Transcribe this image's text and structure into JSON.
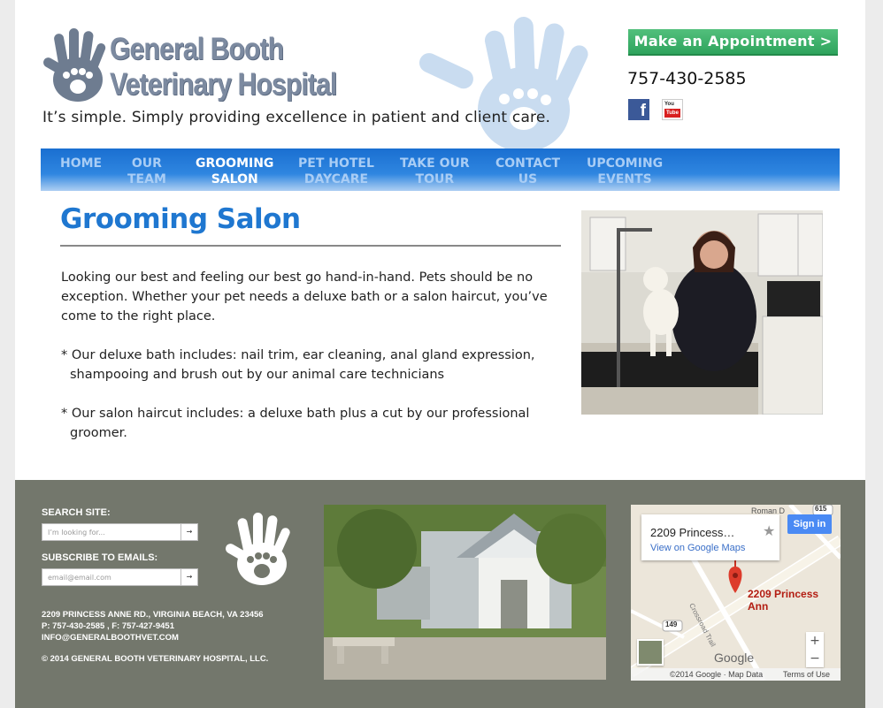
{
  "header": {
    "logo_line1": "General Booth",
    "logo_line2": "Veterinary Hospital",
    "tagline": "It’s simple. Simply providing excellence in patient and client care.",
    "appointment_button": "Make an Appointment >",
    "phone": "757-430-2585",
    "social": {
      "facebook_icon": "facebook-icon",
      "youtube_icon": "youtube-icon",
      "youtube_top": "You",
      "youtube_bottom": "Tube"
    }
  },
  "nav": {
    "items": [
      {
        "line1": "HOME",
        "line2": ""
      },
      {
        "line1": "OUR",
        "line2": "TEAM"
      },
      {
        "line1": "GROOMING",
        "line2": "SALON"
      },
      {
        "line1": "PET HOTEL",
        "line2": "DAYCARE"
      },
      {
        "line1": "TAKE OUR",
        "line2": "TOUR"
      },
      {
        "line1": "CONTACT",
        "line2": "US"
      },
      {
        "line1": "UPCOMING",
        "line2": "EVENTS"
      }
    ],
    "active_index": 2
  },
  "main": {
    "title": "Grooming Salon",
    "paragraphs": [
      "Looking our best and feeling our best go hand-in-hand. Pets should be no exception. Whether your pet needs a deluxe bath or a salon haircut, you’ve come to the right place.",
      "* Our deluxe bath includes: nail trim, ear cleaning, anal gland expression, shampooing and brush out by our animal care technicians",
      "* Our salon haircut includes: a deluxe bath plus a cut by our professional groomer."
    ]
  },
  "footer": {
    "search_label": "SEARCH SITE:",
    "search_placeholder": "I’m looking for...",
    "subscribe_label": "SUBSCRIBE TO EMAILS:",
    "email_placeholder": "email@email.com",
    "go_glyph": "→",
    "address": "2209 PRINCESS ANNE RD., VIRGINIA BEACH, VA 23456",
    "phones": "P: 757-430-2585 , F: 757-427-9451",
    "email": "INFO@GENERALBOOTHVET.COM",
    "copyright": "© 2014 GENERAL BOOTH VETERINARY HOSPITAL, LLC.",
    "map": {
      "card_title": "2209 Princess…",
      "card_link": "View on Google Maps",
      "sign_in": "Sign in",
      "pin_label": "2209 Princess Ann",
      "road_label": "Crossroad Trail",
      "route_149": "149",
      "route_615": "615",
      "road_top": "Roman D",
      "zoom_in": "+",
      "zoom_out": "−",
      "google_logo": "Google",
      "data_credit": "©2014 Google · Map Data",
      "terms": "Terms of Use"
    }
  },
  "colors": {
    "brand_blue": "#1f77d0",
    "nav_blue": "#2f86e0",
    "appointment_green": "#3bb36a",
    "footer_gray": "#73776c"
  }
}
